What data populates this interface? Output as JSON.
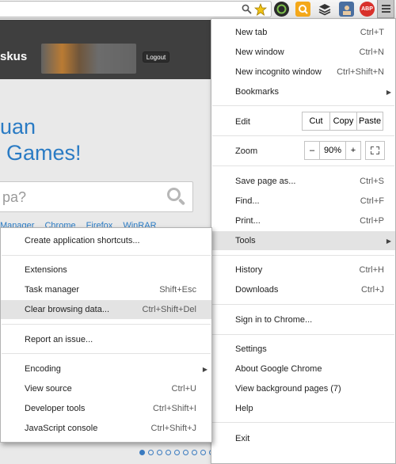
{
  "toolbar": {
    "extensions": [
      {
        "icon": "magnifier-icon"
      },
      {
        "icon": "star-icon",
        "color": "#f2c414"
      },
      {
        "icon": "circle-extension-icon",
        "color": "#2a2a2a"
      },
      {
        "icon": "q-extension-icon",
        "color": "#f4a81a"
      },
      {
        "icon": "layers-icon",
        "color": "#333333"
      },
      {
        "icon": "avatar-extension-icon",
        "color": "#4a6fa0"
      },
      {
        "icon": "adblock-plus-icon",
        "label": "ABP",
        "color": "#d8312b"
      },
      {
        "icon": "menu-icon"
      }
    ]
  },
  "page": {
    "brand_part": "skus",
    "logout": "Logout",
    "hero_line1": "uan",
    "hero_line2": "Games!",
    "search_text": "pa?",
    "links": [
      "Manager",
      "Chrome",
      "Firefox",
      "WinRAR"
    ],
    "accent": "#2a7bc4"
  },
  "main_menu": {
    "new_tab": {
      "label": "New tab",
      "shortcut": "Ctrl+T"
    },
    "new_window": {
      "label": "New window",
      "shortcut": "Ctrl+N"
    },
    "new_incognito": {
      "label": "New incognito window",
      "shortcut": "Ctrl+Shift+N"
    },
    "bookmarks": {
      "label": "Bookmarks"
    },
    "edit": {
      "label": "Edit",
      "cut": "Cut",
      "copy": "Copy",
      "paste": "Paste"
    },
    "zoom": {
      "label": "Zoom",
      "minus": "–",
      "value": "90%",
      "plus": "+"
    },
    "save_page": {
      "label": "Save page as...",
      "shortcut": "Ctrl+S"
    },
    "find": {
      "label": "Find...",
      "shortcut": "Ctrl+F"
    },
    "print": {
      "label": "Print...",
      "shortcut": "Ctrl+P"
    },
    "tools": {
      "label": "Tools"
    },
    "history": {
      "label": "History",
      "shortcut": "Ctrl+H"
    },
    "downloads": {
      "label": "Downloads",
      "shortcut": "Ctrl+J"
    },
    "sign_in": {
      "label": "Sign in to Chrome..."
    },
    "settings": {
      "label": "Settings"
    },
    "about": {
      "label": "About Google Chrome"
    },
    "background_pages": {
      "label": "View background pages (7)"
    },
    "help": {
      "label": "Help"
    },
    "exit": {
      "label": "Exit"
    }
  },
  "tools_menu": {
    "create_shortcuts": {
      "label": "Create application shortcuts..."
    },
    "extensions": {
      "label": "Extensions"
    },
    "task_manager": {
      "label": "Task manager",
      "shortcut": "Shift+Esc"
    },
    "clear_browsing": {
      "label": "Clear browsing data...",
      "shortcut": "Ctrl+Shift+Del"
    },
    "report_issue": {
      "label": "Report an issue..."
    },
    "encoding": {
      "label": "Encoding"
    },
    "view_source": {
      "label": "View source",
      "shortcut": "Ctrl+U"
    },
    "developer_tools": {
      "label": "Developer tools",
      "shortcut": "Ctrl+Shift+I"
    },
    "js_console": {
      "label": "JavaScript console",
      "shortcut": "Ctrl+Shift+J"
    }
  },
  "carousel": {
    "total_dots": 10,
    "active_dot": 1
  }
}
